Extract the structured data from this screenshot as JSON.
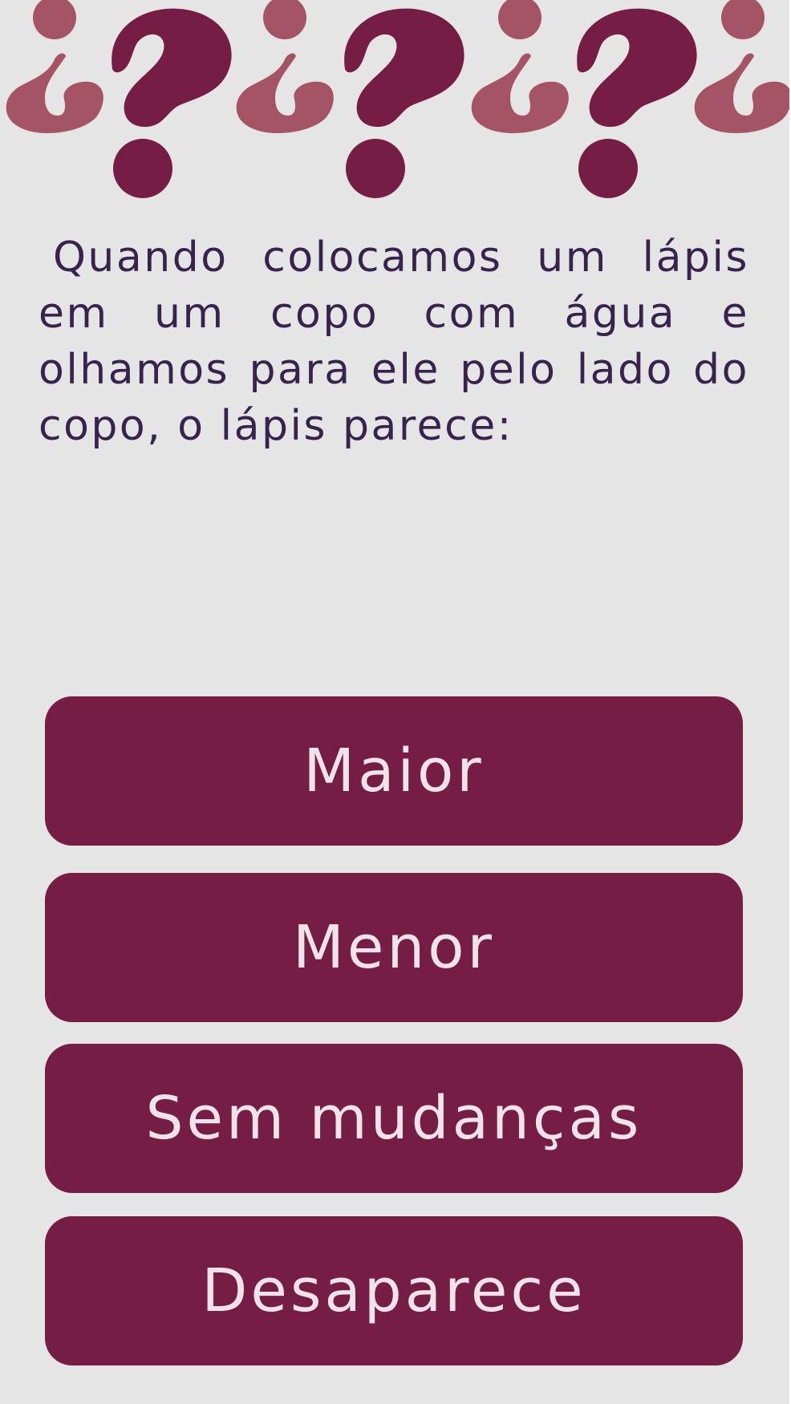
{
  "question": {
    "text": "Quando colocamos um lápis em um copo com água e olhamos para ele pelo lado do copo, o lápis parece:"
  },
  "answers": [
    {
      "label": "Maior"
    },
    {
      "label": "Menor"
    },
    {
      "label": "Sem mudanças"
    },
    {
      "label": "Desaparece"
    }
  ],
  "colors": {
    "background": "#e5e5e6",
    "button": "#761d45",
    "button_text": "#efe3ea",
    "question_text": "#38234e",
    "question_mark_dark": "#761d45",
    "question_mark_light": "#a55466"
  },
  "banner": {
    "icons": [
      "inverted-question-mark-icon",
      "question-mark-icon",
      "inverted-question-mark-icon",
      "question-mark-icon",
      "inverted-question-mark-icon",
      "question-mark-icon",
      "inverted-question-mark-icon"
    ]
  }
}
